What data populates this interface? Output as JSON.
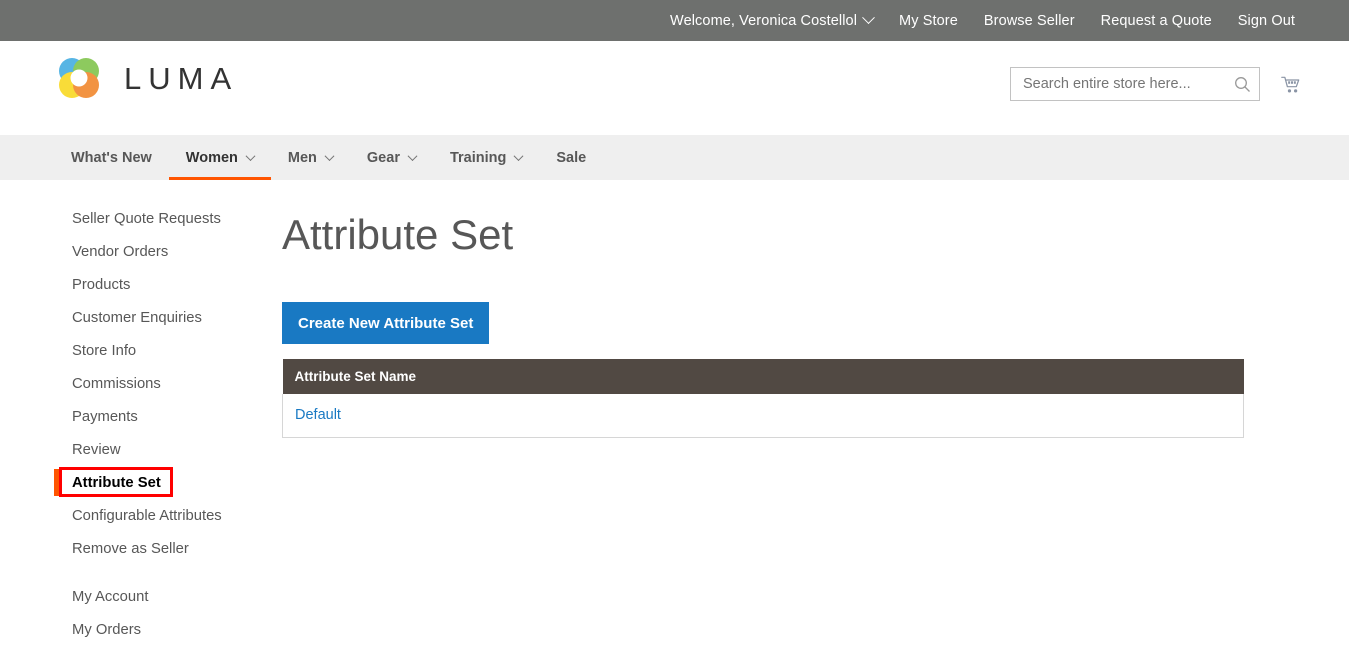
{
  "top_panel": {
    "links": [
      {
        "label": "Welcome, Veronica Costellol",
        "has_caret": true,
        "name": "welcome-user-menu"
      },
      {
        "label": "My Store",
        "has_caret": false,
        "name": "my-store-link"
      },
      {
        "label": "Browse Seller",
        "has_caret": false,
        "name": "browse-seller-link"
      },
      {
        "label": "Request a Quote",
        "has_caret": false,
        "name": "request-a-quote-link"
      },
      {
        "label": "Sign Out",
        "has_caret": false,
        "name": "sign-out-link"
      }
    ]
  },
  "header": {
    "logo_text": "LUMA",
    "logo_icon": "luma-flower-logo",
    "search": {
      "placeholder": "Search entire store here...",
      "value": "",
      "icon": "search-icon"
    },
    "cart_icon": "shopping-cart-icon"
  },
  "nav": {
    "items": [
      {
        "label": "What's New",
        "caret": false,
        "active": false,
        "name": "nav-item-whats-new"
      },
      {
        "label": "Women",
        "caret": true,
        "active": true,
        "name": "nav-item-women"
      },
      {
        "label": "Men",
        "caret": true,
        "active": false,
        "name": "nav-item-men"
      },
      {
        "label": "Gear",
        "caret": true,
        "active": false,
        "name": "nav-item-gear"
      },
      {
        "label": "Training",
        "caret": true,
        "active": false,
        "name": "nav-item-training"
      },
      {
        "label": "Sale",
        "caret": false,
        "active": false,
        "name": "nav-item-sale"
      }
    ]
  },
  "sidebar": {
    "items": [
      {
        "label": "Seller Quote Requests",
        "current": false,
        "spaced": false,
        "name": "sidebar-item-seller-quote-requests"
      },
      {
        "label": "Vendor Orders",
        "current": false,
        "spaced": false,
        "name": "sidebar-item-vendor-orders"
      },
      {
        "label": "Products",
        "current": false,
        "spaced": false,
        "name": "sidebar-item-products"
      },
      {
        "label": "Customer Enquiries",
        "current": false,
        "spaced": false,
        "name": "sidebar-item-customer-enquiries"
      },
      {
        "label": "Store Info",
        "current": false,
        "spaced": false,
        "name": "sidebar-item-store-info"
      },
      {
        "label": "Commissions",
        "current": false,
        "spaced": false,
        "name": "sidebar-item-commissions"
      },
      {
        "label": "Payments",
        "current": false,
        "spaced": false,
        "name": "sidebar-item-payments"
      },
      {
        "label": "Review",
        "current": false,
        "spaced": false,
        "name": "sidebar-item-review"
      },
      {
        "label": "Attribute Set",
        "current": true,
        "spaced": false,
        "name": "sidebar-item-attribute-set"
      },
      {
        "label": "Configurable Attributes",
        "current": false,
        "spaced": false,
        "name": "sidebar-item-configurable-attributes"
      },
      {
        "label": "Remove as Seller",
        "current": false,
        "spaced": false,
        "name": "sidebar-item-remove-as-seller"
      },
      {
        "label": "My Account",
        "current": false,
        "spaced": true,
        "name": "sidebar-item-my-account"
      },
      {
        "label": "My Orders",
        "current": false,
        "spaced": false,
        "name": "sidebar-item-my-orders"
      }
    ]
  },
  "main": {
    "page_title": "Attribute Set",
    "create_button_label": "Create New Attribute Set",
    "table": {
      "columns": [
        "Attribute Set Name"
      ],
      "rows": [
        {
          "name": "Default"
        }
      ]
    }
  },
  "colors": {
    "top_panel_bg": "#6e706e",
    "nav_bg": "#efefef",
    "accent_orange": "#ff5501",
    "primary_blue": "#1979c3",
    "table_header_bg": "#514943",
    "highlight_red": "#ff0000",
    "link_blue": "#1979c3"
  }
}
